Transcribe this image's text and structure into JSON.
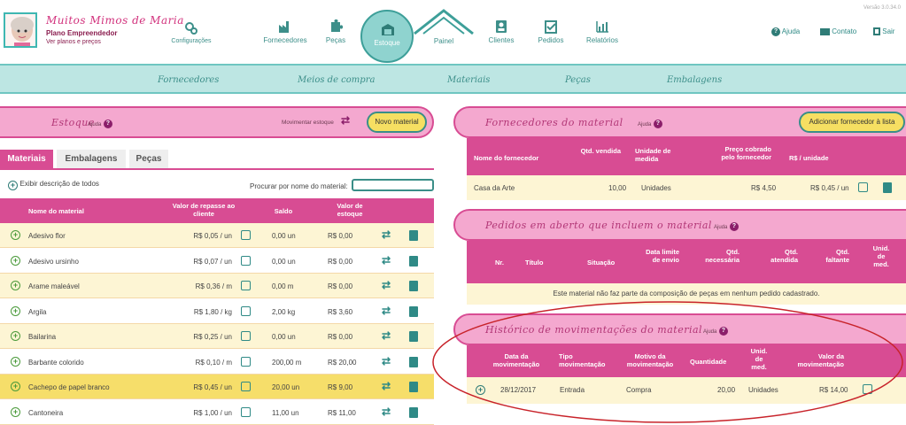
{
  "header": {
    "brand": "Muitos Mimos de Maria",
    "plan": "Plano Empreendedor",
    "plans_link": "Ver planos e preços",
    "version": "Versão 3.0.34.0",
    "config": "Configurações",
    "nav": [
      "Fornecedores",
      "Peças",
      "Estoque",
      "Painel",
      "Clientes",
      "Pedidos",
      "Relatórios"
    ],
    "right": [
      "Ajuda",
      "Contato",
      "Sair"
    ]
  },
  "subnav": [
    "Fornecedores",
    "Meios de compra",
    "Materiais",
    "Peças",
    "Embalagens"
  ],
  "estoque": {
    "title": "Estoque",
    "ajuda": "Ajuda",
    "movimentar": "Movimentar estoque",
    "novo": "Novo material",
    "tabs": [
      "Materiais",
      "Embalagens",
      "Peças"
    ],
    "exibir": "Exibir descrição de todos",
    "procurar": "Procurar por nome do material:",
    "cols": [
      "Nome do material",
      "Valor de repasse ao cliente",
      "Saldo",
      "Valor de estoque"
    ],
    "rows": [
      {
        "nome": "Adesivo flor",
        "repasse": "R$ 0,05 / un",
        "saldo": "0,00 un",
        "valor": "R$ 0,00"
      },
      {
        "nome": "Adesivo ursinho",
        "repasse": "R$ 0,07 / un",
        "saldo": "0,00 un",
        "valor": "R$ 0,00"
      },
      {
        "nome": "Arame maleável",
        "repasse": "R$ 0,36 / m",
        "saldo": "0,00 m",
        "valor": "R$ 0,00"
      },
      {
        "nome": "Argila",
        "repasse": "R$ 1,80 / kg",
        "saldo": "2,00 kg",
        "valor": "R$ 3,60"
      },
      {
        "nome": "Bailarina",
        "repasse": "R$ 0,25 / un",
        "saldo": "0,00 un",
        "valor": "R$ 0,00"
      },
      {
        "nome": "Barbante colorido",
        "repasse": "R$ 0,10 / m",
        "saldo": "200,00 m",
        "valor": "R$ 20,00"
      },
      {
        "nome": "Cachepo de papel branco",
        "repasse": "R$ 0,45 / un",
        "saldo": "20,00 un",
        "valor": "R$ 9,00"
      },
      {
        "nome": "Cantoneira",
        "repasse": "R$ 1,00 / un",
        "saldo": "11,00 un",
        "valor": "R$ 11,00"
      }
    ]
  },
  "fornecedores": {
    "title": "Fornecedores do material",
    "ajuda": "Ajuda",
    "add": "Adicionar fornecedor à lista",
    "cols": [
      "Nome do fornecedor",
      "Qtd. vendida",
      "Unidade de medida",
      "Preço cobrado pelo fornecedor",
      "R$ / unidade"
    ],
    "row": {
      "nome": "Casa da Arte",
      "qtd": "10,00",
      "unidade": "Unidades",
      "preco": "R$ 4,50",
      "unit": "R$ 0,45 / un"
    }
  },
  "pedidos": {
    "title": "Pedidos em aberto que incluem o material",
    "ajuda": "Ajuda",
    "cols": [
      "Nr.",
      "Título",
      "Situação",
      "Data limite de envio",
      "Qtd. necessária",
      "Qtd. atendida",
      "Qtd. faltante",
      "Unid. de med."
    ],
    "empty": "Este material não faz parte da composição de peças em nenhum pedido cadastrado."
  },
  "historico": {
    "title": "Histórico de movimentações do material",
    "ajuda": "Ajuda",
    "cols": [
      "Data da movimentação",
      "Tipo movimentação",
      "Motivo da movimentação",
      "Quantidade",
      "Unid. de med.",
      "Valor da movimentação"
    ],
    "row": {
      "data": "28/12/2017",
      "tipo": "Entrada",
      "motivo": "Compra",
      "qtd": "20,00",
      "unid": "Unidades",
      "valor": "R$ 14,00"
    }
  },
  "colors": {
    "pink": "#d84c93",
    "teal": "#3fb7b2",
    "yellow": "#f6df62"
  }
}
